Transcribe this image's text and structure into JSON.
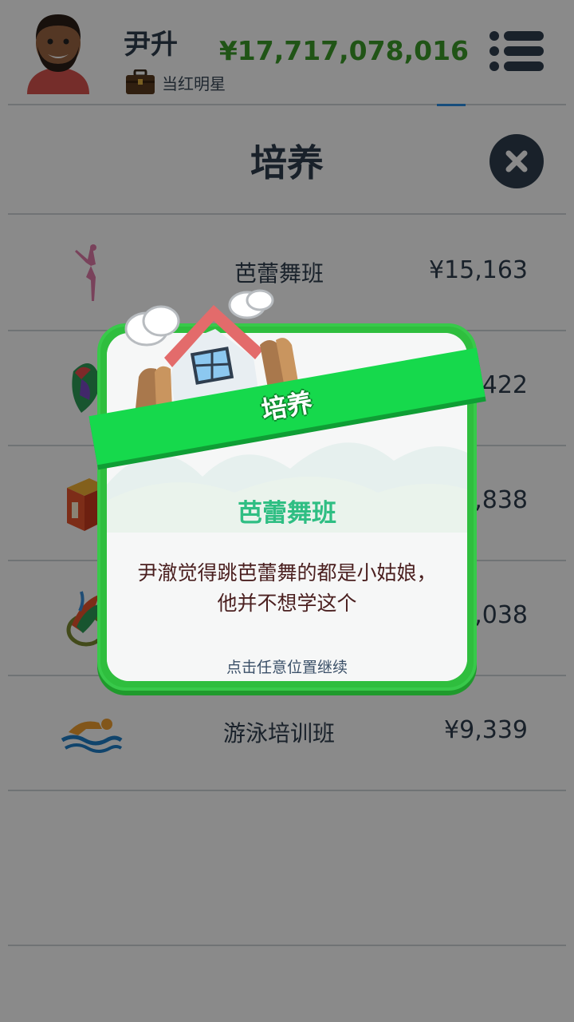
{
  "header": {
    "player_name": "尹升",
    "job_title": "当红明星",
    "money": "¥17,717,078,016"
  },
  "page": {
    "title": "培养"
  },
  "courses": [
    {
      "name": "芭蕾舞班",
      "price": "¥15,163",
      "icon": "ballet-dancer-icon"
    },
    {
      "name": "",
      "price": "422",
      "icon": "parrot-art-icon"
    },
    {
      "name": "",
      "price": ",838",
      "icon": "blocks-icon"
    },
    {
      "name": "",
      "price": ",038",
      "icon": "badminton-icon"
    },
    {
      "name": "游泳培训班",
      "price": "¥9,339",
      "icon": "swimmer-icon"
    }
  ],
  "popup": {
    "ribbon_title": "培养",
    "item_name": "芭蕾舞班",
    "message": "尹澈觉得跳芭蕾舞的都是小姑娘，他并不想学这个",
    "continue_hint": "点击任意位置继续"
  },
  "colors": {
    "money": "#3b9c2a",
    "accent_green": "#16d94c",
    "item_name": "#2fbe83",
    "text_dark": "#2f3e4f"
  }
}
